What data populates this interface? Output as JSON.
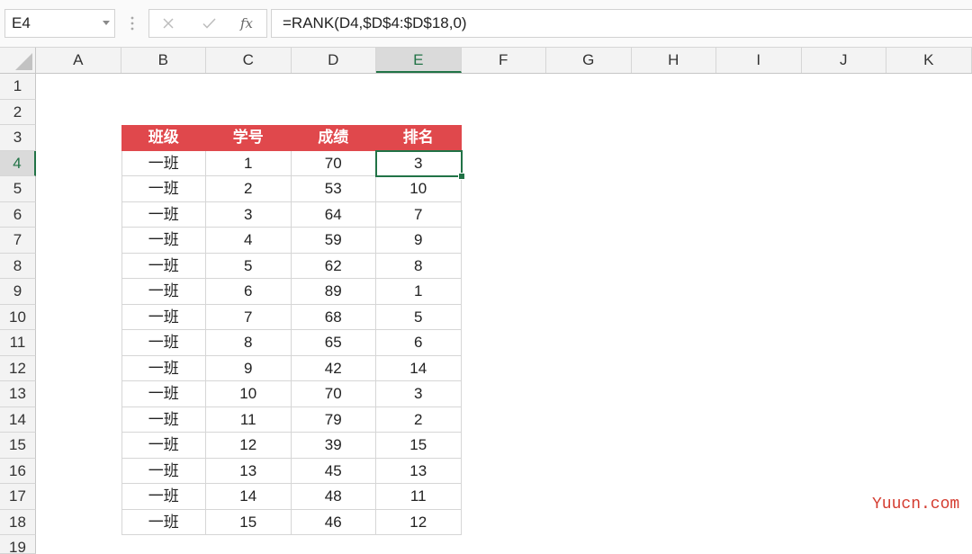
{
  "formula_bar": {
    "name_box": "E4",
    "name_box_icon": "chevron-down-icon",
    "handle_icon": "vertical-ellipsis-icon",
    "cancel_icon": "close-icon",
    "enter_icon": "check-icon",
    "function_label": "fx",
    "formula": "=RANK(D4,$D$4:$D$18,0)"
  },
  "sheet": {
    "select_all_icon": "select-all-triangle-icon",
    "columns": [
      "A",
      "B",
      "C",
      "D",
      "E",
      "F",
      "G",
      "H",
      "I",
      "J",
      "K"
    ],
    "rows": [
      1,
      2,
      3,
      4,
      5,
      6,
      7,
      8,
      9,
      10,
      11,
      12,
      13,
      14,
      15,
      16,
      17,
      18,
      19
    ],
    "gridlines": false
  },
  "table": {
    "headers": [
      "班级",
      "学号",
      "成绩",
      "排名"
    ],
    "rows": [
      [
        "一班",
        1,
        70,
        3
      ],
      [
        "一班",
        2,
        53,
        10
      ],
      [
        "一班",
        3,
        64,
        7
      ],
      [
        "一班",
        4,
        59,
        9
      ],
      [
        "一班",
        5,
        62,
        8
      ],
      [
        "一班",
        6,
        89,
        1
      ],
      [
        "一班",
        7,
        68,
        5
      ],
      [
        "一班",
        8,
        65,
        6
      ],
      [
        "一班",
        9,
        42,
        14
      ],
      [
        "一班",
        10,
        70,
        3
      ],
      [
        "一班",
        11,
        79,
        2
      ],
      [
        "一班",
        12,
        39,
        15
      ],
      [
        "一班",
        13,
        45,
        13
      ],
      [
        "一班",
        14,
        48,
        11
      ],
      [
        "一班",
        15,
        46,
        12
      ]
    ]
  },
  "colors": {
    "header_fill": "#e0484c",
    "header_text": "#ffffff",
    "selection": "#217346",
    "watermark": "#d43b2f"
  },
  "watermark": "Yuucn.com"
}
